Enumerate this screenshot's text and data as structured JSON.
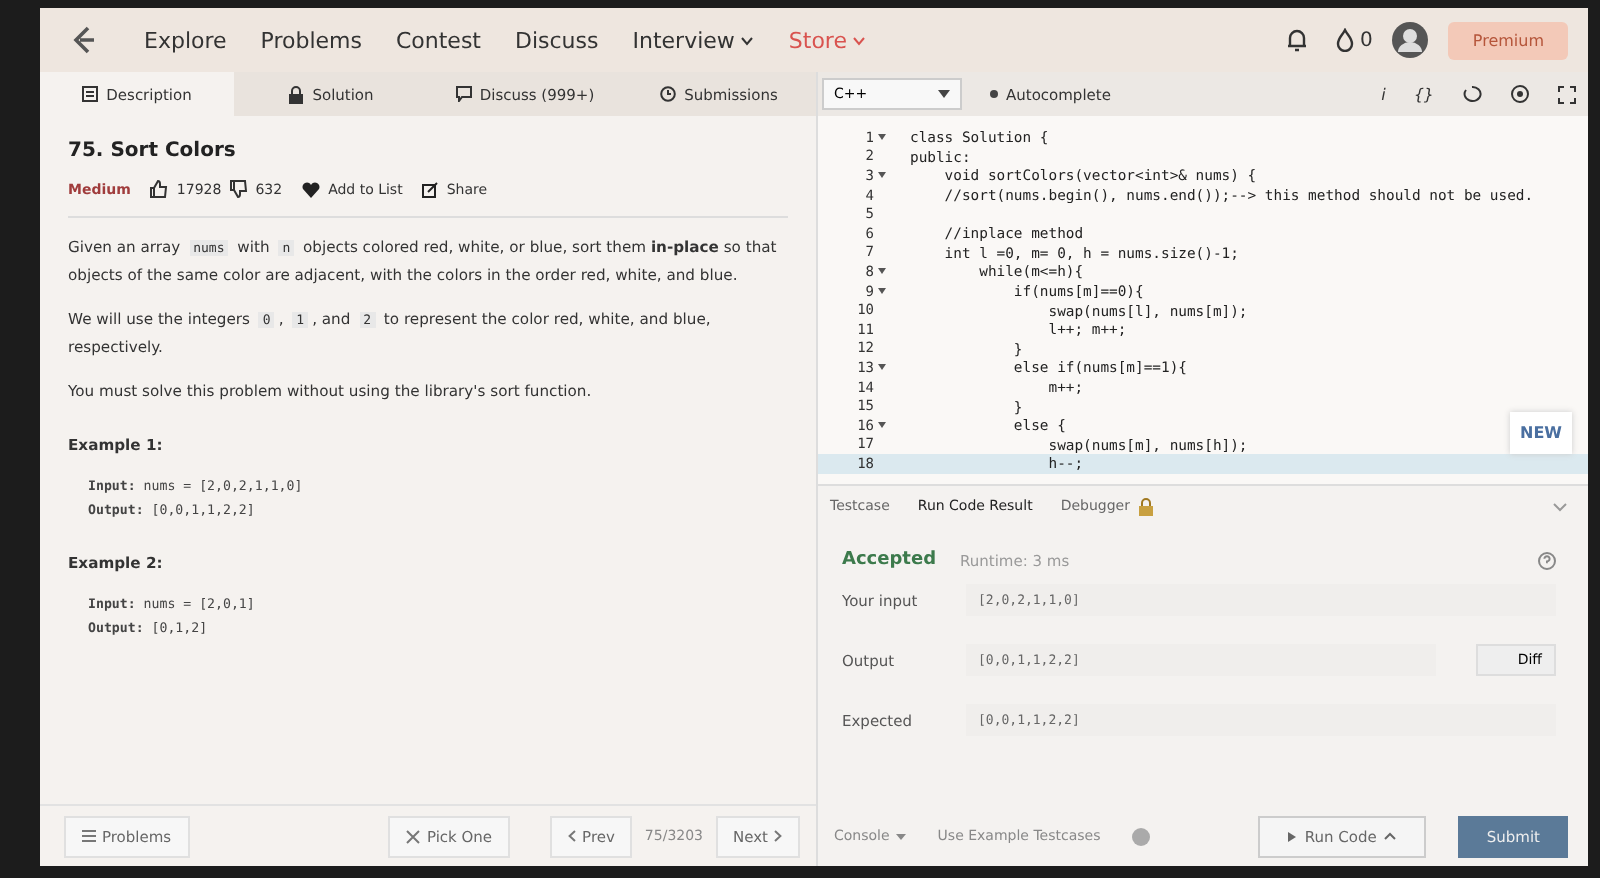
{
  "nav": {
    "links": [
      {
        "label": "Explore",
        "dropdown": false,
        "accent": false
      },
      {
        "label": "Problems",
        "dropdown": false,
        "accent": false
      },
      {
        "label": "Contest",
        "dropdown": false,
        "accent": false
      },
      {
        "label": "Discuss",
        "dropdown": false,
        "accent": false
      },
      {
        "label": "Interview",
        "dropdown": true,
        "accent": false
      },
      {
        "label": "Store",
        "dropdown": true,
        "accent": true
      }
    ],
    "streak": "0",
    "premium": "Premium"
  },
  "left_tabs": [
    {
      "label": "Description",
      "selected": true
    },
    {
      "label": "Solution",
      "selected": false
    },
    {
      "label": "Discuss (999+)",
      "selected": false
    },
    {
      "label": "Submissions",
      "selected": false
    }
  ],
  "problem": {
    "title": "75. Sort Colors",
    "difficulty": "Medium",
    "likes": "17928",
    "dislikes": "632",
    "add_to_list": "Add to List",
    "share": "Share",
    "paragraphs": [
      [
        {
          "kind": "text",
          "text": "Given an array "
        },
        {
          "kind": "code",
          "text": "nums"
        },
        {
          "kind": "text",
          "text": " with "
        },
        {
          "kind": "code",
          "text": "n"
        },
        {
          "kind": "text",
          "text": " objects colored red, white, or blue, sort them **in-place** so that objects of the same color are adjacent, with the colors in the order red, white, and blue."
        }
      ],
      [
        {
          "kind": "text",
          "text": "We will use the integers "
        },
        {
          "kind": "code",
          "text": "0"
        },
        {
          "kind": "text",
          "text": ", "
        },
        {
          "kind": "code",
          "text": "1"
        },
        {
          "kind": "text",
          "text": ", and "
        },
        {
          "kind": "code",
          "text": "2"
        },
        {
          "kind": "text",
          "text": " to represent the color red, white, and blue, respectively."
        }
      ],
      [
        {
          "kind": "text",
          "text": "You must solve this problem without using the library's sort function."
        }
      ]
    ],
    "examples": [
      {
        "title": "Example 1:",
        "input_label": "Input:",
        "input": "nums = [2,0,2,1,1,0]",
        "output_label": "Output:",
        "output": "[0,0,1,1,2,2]"
      },
      {
        "title": "Example 2:",
        "input_label": "Input:",
        "input": "nums = [2,0,1]",
        "output_label": "Output:",
        "output": "[0,1,2]"
      }
    ]
  },
  "left_footer": {
    "problems": "Problems",
    "pick_one": "Pick One",
    "prev": "Prev",
    "position": "75/3203",
    "next": "Next"
  },
  "editor": {
    "language": "C++",
    "autocomplete": "Autocomplete",
    "info": "i",
    "braces": "{}",
    "new_badge": "NEW",
    "lines": [
      {
        "num": "1",
        "fold": true,
        "highlighted": false,
        "text": "class Solution {"
      },
      {
        "num": "2",
        "fold": false,
        "highlighted": false,
        "text": "public:"
      },
      {
        "num": "3",
        "fold": true,
        "highlighted": false,
        "text": "    void sortColors(vector<int>& nums) {"
      },
      {
        "num": "4",
        "fold": false,
        "highlighted": false,
        "text": "    //sort(nums.begin(), nums.end());--> this method should not be used."
      },
      {
        "num": "5",
        "fold": false,
        "highlighted": false
      },
      {
        "num": "6",
        "fold": false,
        "highlighted": false,
        "text": "    //inplace method"
      },
      {
        "num": "7",
        "fold": false,
        "highlighted": false,
        "text": "    int l =0, m= 0, h = nums.size()-1;"
      },
      {
        "num": "8",
        "fold": true,
        "highlighted": false,
        "text": "        while(m<=h){"
      },
      {
        "num": "9",
        "fold": true,
        "highlighted": false,
        "text": "            if(nums[m]==0){"
      },
      {
        "num": "10",
        "fold": false,
        "highlighted": false,
        "text": "                swap(nums[l], nums[m]);"
      },
      {
        "num": "11",
        "fold": false,
        "highlighted": false,
        "text": "                l++; m++;"
      },
      {
        "num": "12",
        "fold": false,
        "highlighted": false,
        "text": "            }"
      },
      {
        "num": "13",
        "fold": true,
        "highlighted": false,
        "text": "            else if(nums[m]==1){"
      },
      {
        "num": "14",
        "fold": false,
        "highlighted": false,
        "text": "                m++;"
      },
      {
        "num": "15",
        "fold": false,
        "highlighted": false,
        "text": "            }"
      },
      {
        "num": "16",
        "fold": true,
        "highlighted": false,
        "text": "            else {"
      },
      {
        "num": "17",
        "fold": false,
        "highlighted": false,
        "text": "                swap(nums[m], nums[h]);"
      },
      {
        "num": "18",
        "fold": false,
        "highlighted": true,
        "text": "                h--;"
      }
    ]
  },
  "result_tabs": [
    {
      "label": "Testcase",
      "locked": false,
      "selected": false
    },
    {
      "label": "Run Code Result",
      "locked": false,
      "selected": true
    },
    {
      "label": "Debugger",
      "locked": true,
      "selected": false
    }
  ],
  "result": {
    "status": "Accepted",
    "runtime": "Runtime: 3 ms",
    "rows": [
      {
        "label": "Your input",
        "value": "[2,0,2,1,1,0]"
      },
      {
        "label": "Output",
        "value": "[0,0,1,1,2,2]"
      },
      {
        "label": "Expected",
        "value": "[0,0,1,1,2,2]"
      }
    ],
    "diff": "Diff"
  },
  "right_footer": {
    "console": "Console",
    "use_example": "Use Example Testcases",
    "run_code": "Run Code",
    "submit": "Submit"
  }
}
